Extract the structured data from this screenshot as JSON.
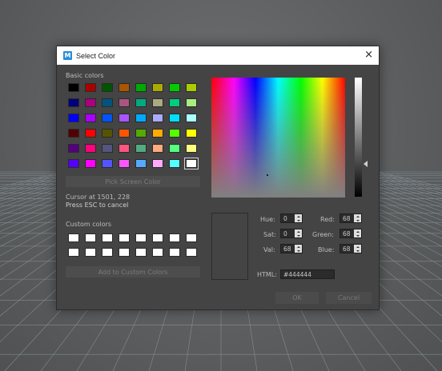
{
  "dialog": {
    "title": "Select Color",
    "app_icon_glyph": "M",
    "close_glyph": "×",
    "basic_colors_label": "Basic colors",
    "pick_screen_color_label": "Pick Screen Color",
    "cursor_text": "Cursor at 1501, 228",
    "esc_hint": "Press ESC to cancel",
    "custom_colors_label": "Custom colors",
    "add_custom_label": "Add to Custom Colors",
    "ok_label": "OK",
    "cancel_label": "Cancel"
  },
  "basic_colors": [
    [
      "#000000",
      "#aa0000",
      "#005500",
      "#aa5500",
      "#00aa00",
      "#aaaa00",
      "#00cc00",
      "#aacc00"
    ],
    [
      "#00007f",
      "#aa007f",
      "#00557f",
      "#aa557f",
      "#00aa7f",
      "#aaaa7f",
      "#00cc7f",
      "#aaee7f"
    ],
    [
      "#0000ff",
      "#aa00ff",
      "#0055ff",
      "#aa55ff",
      "#00aaff",
      "#aaaaff",
      "#00ddff",
      "#aaffff"
    ],
    [
      "#550000",
      "#ff0000",
      "#555500",
      "#ff5500",
      "#55aa00",
      "#ffaa00",
      "#55ff00",
      "#ffff00"
    ],
    [
      "#55007f",
      "#ff007f",
      "#55557f",
      "#ff557f",
      "#55aa7f",
      "#ffaa7f",
      "#55ff7f",
      "#ffff7f"
    ],
    [
      "#5500ff",
      "#ff00ff",
      "#5555ff",
      "#ff55ff",
      "#55aaff",
      "#ffaaff",
      "#55ffff",
      "#ffffff"
    ]
  ],
  "selected_basic": [
    5,
    7
  ],
  "custom_colors": [
    [
      "#ffffff",
      "#ffffff",
      "#ffffff",
      "#ffffff",
      "#ffffff",
      "#ffffff",
      "#ffffff",
      "#ffffff"
    ],
    [
      "#ffffff",
      "#ffffff",
      "#ffffff",
      "#ffffff",
      "#ffffff",
      "#ffffff",
      "#ffffff",
      "#ffffff"
    ]
  ],
  "fields": {
    "hue": {
      "label": "Hue:",
      "value": "0"
    },
    "sat": {
      "label": "Sat:",
      "value": "0"
    },
    "val": {
      "label": "Val:",
      "value": "68"
    },
    "red": {
      "label": "Red:",
      "value": "68"
    },
    "green": {
      "label": "Green:",
      "value": "68"
    },
    "blue": {
      "label": "Blue:",
      "value": "68"
    },
    "html": {
      "label": "HTML:",
      "value": "#444444"
    }
  },
  "current_color": "#444444",
  "colors": {
    "dialog_bg": "#444444",
    "viewport_bg": "#5f6162",
    "grid_line": "#8fa0a8"
  }
}
